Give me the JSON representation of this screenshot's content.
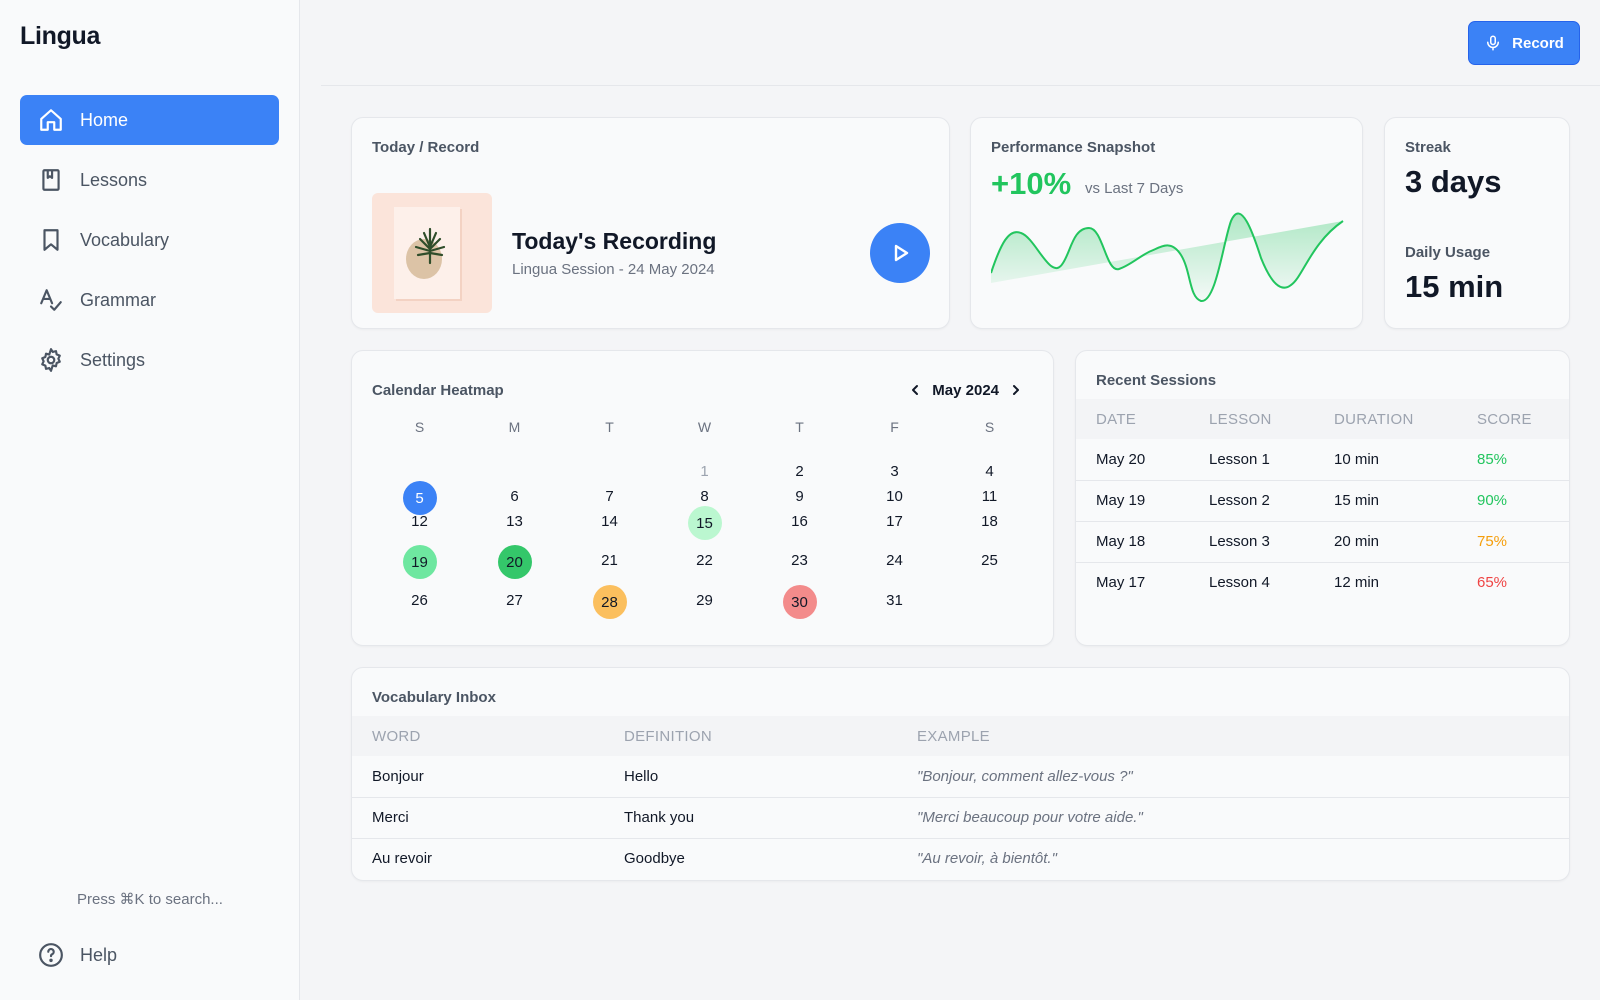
{
  "app": {
    "name": "Lingua"
  },
  "sidebar": {
    "items": [
      {
        "label": "Home",
        "icon": "home-icon",
        "active": true
      },
      {
        "label": "Lessons",
        "icon": "book-icon",
        "active": false
      },
      {
        "label": "Vocabulary",
        "icon": "bookmark-icon",
        "active": false
      },
      {
        "label": "Grammar",
        "icon": "spellcheck-icon",
        "active": false
      },
      {
        "label": "Settings",
        "icon": "gear-icon",
        "active": false
      }
    ],
    "search_hint": "Press ⌘K to search...",
    "help_label": "Help"
  },
  "topbar": {
    "record_label": "Record"
  },
  "today": {
    "title": "Today / Record",
    "recording_title": "Today's Recording",
    "recording_subtitle": "Lingua Session - 24 May 2024"
  },
  "performance": {
    "title": "Performance Snapshot",
    "change": "+10%",
    "comparison": "vs Last 7 Days"
  },
  "streak": {
    "streak_label": "Streak",
    "streak_value": "3 days",
    "usage_label": "Daily Usage",
    "usage_value": "15 min"
  },
  "calendar": {
    "title": "Calendar Heatmap",
    "month_label": "May 2024",
    "weekdays": [
      "S",
      "M",
      "T",
      "W",
      "T",
      "F",
      "S"
    ],
    "first_weekday_index": 3,
    "days_in_month": 31,
    "highlights": [
      {
        "day": 5,
        "color": "#3b82f6",
        "text_color": "#ffffff"
      },
      {
        "day": 15,
        "color": "#bbf7d0",
        "text_color": "#111827"
      },
      {
        "day": 19,
        "color": "#6ee7a0",
        "text_color": "#111827"
      },
      {
        "day": 20,
        "color": "#34c76a",
        "text_color": "#111827"
      },
      {
        "day": 28,
        "color": "#fbbf5e",
        "text_color": "#111827"
      },
      {
        "day": 30,
        "color": "#f38b8b",
        "text_color": "#111827"
      }
    ],
    "muted_days": [
      1
    ]
  },
  "recent_sessions": {
    "title": "Recent Sessions",
    "columns": [
      "DATE",
      "LESSON",
      "DURATION",
      "SCORE"
    ],
    "rows": [
      {
        "date": "May 20",
        "lesson": "Lesson 1",
        "duration": "10 min",
        "score": "85%",
        "score_color": "#22c55e"
      },
      {
        "date": "May 19",
        "lesson": "Lesson 2",
        "duration": "15 min",
        "score": "90%",
        "score_color": "#22c55e"
      },
      {
        "date": "May 18",
        "lesson": "Lesson 3",
        "duration": "20 min",
        "score": "75%",
        "score_color": "#f59e0b"
      },
      {
        "date": "May 17",
        "lesson": "Lesson 4",
        "duration": "12 min",
        "score": "65%",
        "score_color": "#ef4444"
      }
    ]
  },
  "vocabulary_inbox": {
    "title": "Vocabulary Inbox",
    "columns": [
      "WORD",
      "DEFINITION",
      "EXAMPLE"
    ],
    "rows": [
      {
        "word": "Bonjour",
        "definition": "Hello",
        "example": "\"Bonjour, comment allez-vous ?\""
      },
      {
        "word": "Merci",
        "definition": "Thank you",
        "example": "\"Merci beaucoup pour votre aide.\""
      },
      {
        "word": "Au revoir",
        "definition": "Goodbye",
        "example": "\"Au revoir, à bientôt.\""
      }
    ]
  },
  "colors": {
    "accent": "#3b82f6",
    "positive": "#22c55e"
  }
}
